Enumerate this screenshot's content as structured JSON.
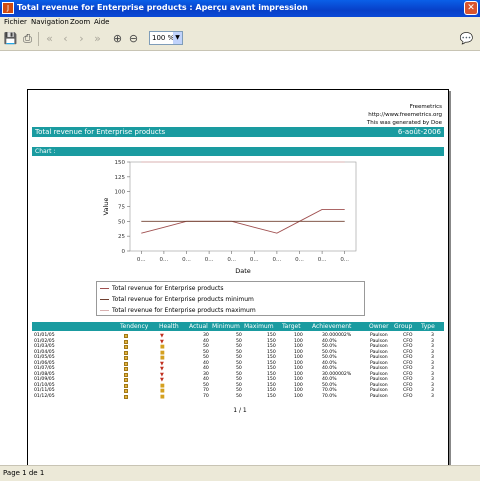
{
  "window": {
    "title": "Total revenue for Enterprise products : Aperçu avant impression",
    "close_glyph": "✕"
  },
  "menu": {
    "file": "Fichier",
    "navigation": "Navigation",
    "zoom": "Zoom",
    "help": "Aide"
  },
  "toolbar": {
    "zoom_value": "100 %"
  },
  "report": {
    "brand": "Freemetrics",
    "url": "http://www.freemetrics.org",
    "generated_by": "This was generated by Doe",
    "title": "Total revenue for Enterprise products",
    "date": "6-août-2006",
    "chart_section": "Chart :",
    "page_indicator": "1 / 1"
  },
  "chart_data": {
    "type": "line",
    "xlabel": "Date",
    "ylabel": "Value",
    "ylim": [
      0,
      150
    ],
    "yticks": [
      0,
      25,
      50,
      75,
      100,
      125,
      150
    ],
    "x_tick_labels": [
      "0...",
      "0...",
      "0...",
      "0...",
      "0...",
      "0...",
      "0...",
      "0...",
      "0...",
      "0..."
    ],
    "series": [
      {
        "name": "Total revenue for Enterprise products",
        "color": "#a05050",
        "values": [
          30,
          40,
          50,
          50,
          50,
          40,
          30,
          50,
          70,
          70
        ]
      },
      {
        "name": "Total revenue for Enterprise products minimum",
        "color": "#704030",
        "values": [
          50,
          50,
          50,
          50,
          50,
          50,
          50,
          50,
          50,
          50
        ]
      },
      {
        "name": "Total revenue for Enterprise products maximum",
        "color": "#d8b0b0",
        "values": [
          150,
          150,
          150,
          150,
          150,
          150,
          150,
          150,
          150,
          150
        ]
      }
    ],
    "legend": [
      "Total revenue for Enterprise products",
      "Total revenue for Enterprise products minimum",
      "Total revenue for Enterprise products maximum"
    ]
  },
  "table": {
    "headers": [
      "Tendency",
      "Health",
      "Actual",
      "Minimum",
      "Maximum",
      "Target",
      "Achievement",
      "Owner",
      "Group",
      "Type"
    ],
    "rows": [
      {
        "date": "01/01/05",
        "health": "▼",
        "actual": "30",
        "min": "50",
        "max": "150",
        "target": "100",
        "ach": "30.000002%",
        "owner": "Paulson",
        "group": "CFO",
        "type": "3"
      },
      {
        "date": "01/02/05",
        "health": "▼",
        "actual": "40",
        "min": "50",
        "max": "150",
        "target": "100",
        "ach": "40.0%",
        "owner": "Paulson",
        "group": "CFO",
        "type": "3"
      },
      {
        "date": "01/03/05",
        "health": "■",
        "actual": "50",
        "min": "50",
        "max": "150",
        "target": "100",
        "ach": "50.0%",
        "owner": "Paulson",
        "group": "CFO",
        "type": "3"
      },
      {
        "date": "01/04/05",
        "health": "■",
        "actual": "50",
        "min": "50",
        "max": "150",
        "target": "100",
        "ach": "50.0%",
        "owner": "Paulson",
        "group": "CFO",
        "type": "3"
      },
      {
        "date": "01/05/05",
        "health": "■",
        "actual": "50",
        "min": "50",
        "max": "150",
        "target": "100",
        "ach": "50.0%",
        "owner": "Paulson",
        "group": "CFO",
        "type": "3"
      },
      {
        "date": "01/06/05",
        "health": "▼",
        "actual": "40",
        "min": "50",
        "max": "150",
        "target": "100",
        "ach": "40.0%",
        "owner": "Paulson",
        "group": "CFO",
        "type": "3"
      },
      {
        "date": "01/07/05",
        "health": "▼",
        "actual": "40",
        "min": "50",
        "max": "150",
        "target": "100",
        "ach": "40.0%",
        "owner": "Paulson",
        "group": "CFO",
        "type": "3"
      },
      {
        "date": "01/08/05",
        "health": "▼",
        "actual": "30",
        "min": "50",
        "max": "150",
        "target": "100",
        "ach": "30.000002%",
        "owner": "Paulson",
        "group": "CFO",
        "type": "3"
      },
      {
        "date": "01/09/05",
        "health": "▼",
        "actual": "40",
        "min": "50",
        "max": "150",
        "target": "100",
        "ach": "40.0%",
        "owner": "Paulson",
        "group": "CFO",
        "type": "3"
      },
      {
        "date": "01/10/05",
        "health": "■",
        "actual": "50",
        "min": "50",
        "max": "150",
        "target": "100",
        "ach": "50.0%",
        "owner": "Paulson",
        "group": "CFO",
        "type": "3"
      },
      {
        "date": "01/11/05",
        "health": "■",
        "actual": "70",
        "min": "50",
        "max": "150",
        "target": "100",
        "ach": "70.0%",
        "owner": "Paulson",
        "group": "CFO",
        "type": "3"
      },
      {
        "date": "01/12/05",
        "health": "■",
        "actual": "70",
        "min": "50",
        "max": "150",
        "target": "100",
        "ach": "70.0%",
        "owner": "Paulson",
        "group": "CFO",
        "type": "3"
      }
    ]
  },
  "status": {
    "text": "Page 1 de 1"
  },
  "colors": {
    "band": "#1a9ba0",
    "titlebar": "#0a49d6"
  }
}
